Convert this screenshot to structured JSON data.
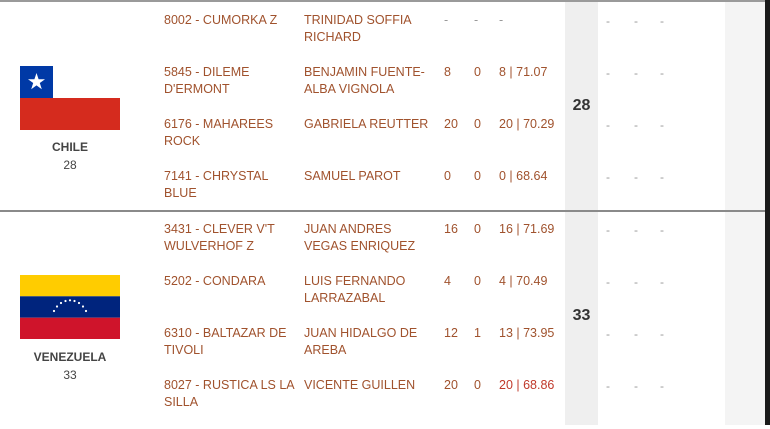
{
  "teams": [
    {
      "country": "CHILE",
      "score": "28",
      "total": "28",
      "flag": "chile-flag",
      "rows": [
        {
          "horse": "8002 - CUMORKA Z",
          "rider": "TRINIDAD SOFFIA RICHARD",
          "r1": "-",
          "r2": "-",
          "total": "-",
          "red": false
        },
        {
          "horse": "5845 - DILEME D'ERMONT",
          "rider": "BENJAMIN FUENTE-ALBA VIGNOLA",
          "r1": "8",
          "r2": "0",
          "total": "8 | 71.07",
          "red": false
        },
        {
          "horse": "6176 - MAHAREES ROCK",
          "rider": "GABRIELA REUTTER",
          "r1": "20",
          "r2": "0",
          "total": "20 | 70.29",
          "red": false
        },
        {
          "horse": "7141 - CHRYSTAL BLUE",
          "rider": "SAMUEL PAROT",
          "r1": "0",
          "r2": "0",
          "total": "0 | 68.64",
          "red": false
        }
      ]
    },
    {
      "country": "VENEZUELA",
      "score": "33",
      "total": "33",
      "flag": "venezuela-flag",
      "rows": [
        {
          "horse": "3431 - CLEVER V'T WULVERHOF Z",
          "rider": "JUAN ANDRES VEGAS ENRIQUEZ",
          "r1": "16",
          "r2": "0",
          "total": "16 | 71.69",
          "red": false
        },
        {
          "horse": "5202 - CONDARA",
          "rider": "LUIS FERNANDO LARRAZABAL",
          "r1": "4",
          "r2": "0",
          "total": "4 | 70.49",
          "red": false
        },
        {
          "horse": "6310 - BALTAZAR DE TIVOLI",
          "rider": "JUAN HIDALGO DE AREBA",
          "r1": "12",
          "r2": "1",
          "total": "13 | 73.95",
          "red": false
        },
        {
          "horse": "8027 - RUSTICA LS LA SILLA",
          "rider": "VICENTE GUILLEN",
          "r1": "20",
          "r2": "0",
          "total": "20 | 68.86",
          "red": true
        }
      ]
    }
  ],
  "placeholder_dash": "-",
  "colors": {
    "link": "#a0522d",
    "highlight": "#c0392b",
    "chile_red": "#d52b1e",
    "chile_blue": "#0039a6",
    "ven_yellow": "#ffcc00",
    "ven_blue": "#00247d",
    "ven_red": "#cf142b"
  }
}
